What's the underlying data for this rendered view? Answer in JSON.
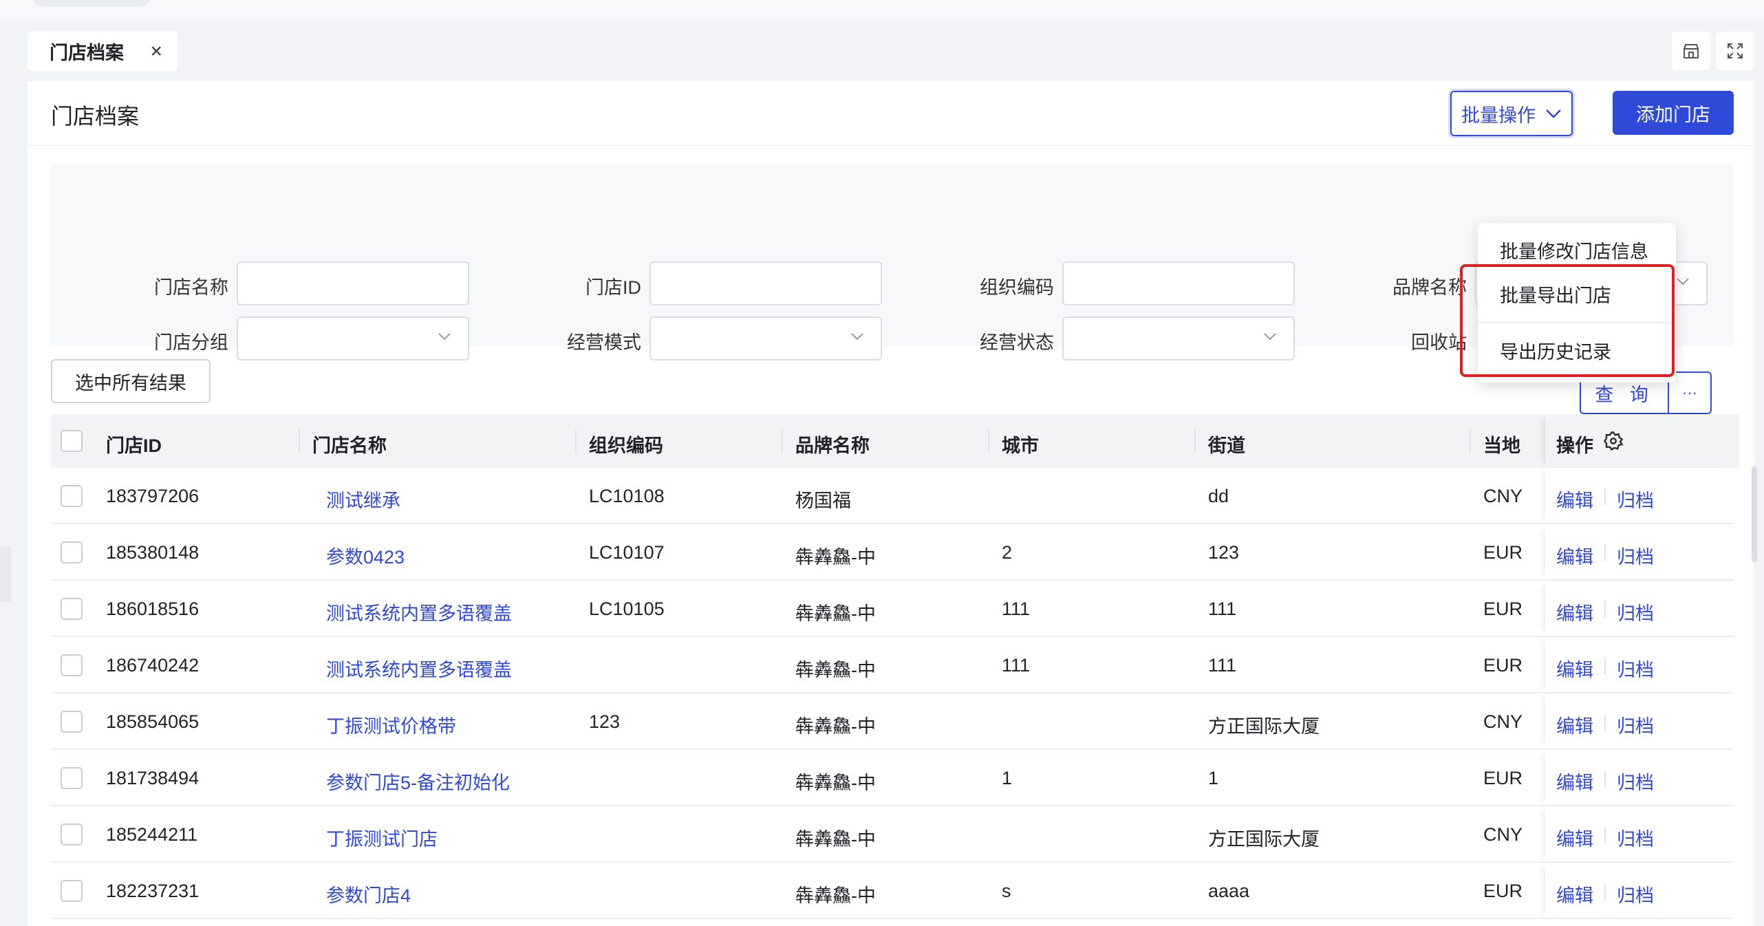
{
  "tab": {
    "label": "门店档案",
    "close": "×"
  },
  "header": {
    "title": "门店档案",
    "batch_label": "批量操作",
    "add_label": "添加门店"
  },
  "filters": {
    "store_name": "门店名称",
    "store_id": "门店ID",
    "org_code": "组织编码",
    "brand_name": "品牌名称",
    "store_group": "门店分组",
    "business_mode": "经营模式",
    "business_status": "经营状态",
    "recycle": "回收站",
    "query_label": "查 询",
    "more_label": "···"
  },
  "select_all_label": "选中所有结果",
  "table": {
    "columns": [
      "门店ID",
      "门店名称",
      "组织编码",
      "品牌名称",
      "城市",
      "街道",
      "当地",
      "操作"
    ],
    "rows": [
      {
        "id": "183797206",
        "name": "测试继承",
        "org": "LC10108",
        "brand": "杨国福",
        "city": "",
        "street": "dd",
        "currency": "CNY"
      },
      {
        "id": "185380148",
        "name": "参数0423",
        "org": "LC10107",
        "brand": "犇羴鱻-中",
        "city": "2",
        "street": "123",
        "currency": "EUR"
      },
      {
        "id": "186018516",
        "name": "测试系统内置多语覆盖",
        "org": "LC10105",
        "brand": "犇羴鱻-中",
        "city": "111",
        "street": "111",
        "currency": "EUR"
      },
      {
        "id": "186740242",
        "name": "测试系统内置多语覆盖",
        "org": "",
        "brand": "犇羴鱻-中",
        "city": "111",
        "street": "111",
        "currency": "EUR"
      },
      {
        "id": "185854065",
        "name": "丁振测试价格带",
        "org": "123",
        "brand": "犇羴鱻-中",
        "city": "",
        "street": "方正国际大厦",
        "currency": "CNY"
      },
      {
        "id": "181738494",
        "name": "参数门店5-备注初始化",
        "org": "",
        "brand": "犇羴鱻-中",
        "city": "1",
        "street": "1",
        "currency": "EUR"
      },
      {
        "id": "185244211",
        "name": "丁振测试门店",
        "org": "",
        "brand": "犇羴鱻-中",
        "city": "",
        "street": "方正国际大厦",
        "currency": "CNY"
      },
      {
        "id": "182237231",
        "name": "参数门店4",
        "org": "",
        "brand": "犇羴鱻-中",
        "city": "s",
        "street": "aaaa",
        "currency": "EUR"
      }
    ],
    "edit_label": "编辑",
    "archive_label": "归档"
  },
  "dropdown": {
    "items": [
      "批量修改门店信息",
      "批量导出门店",
      "导出历史记录"
    ]
  },
  "colors": {
    "primary": "#2f49d9",
    "highlight": "#e02020"
  }
}
